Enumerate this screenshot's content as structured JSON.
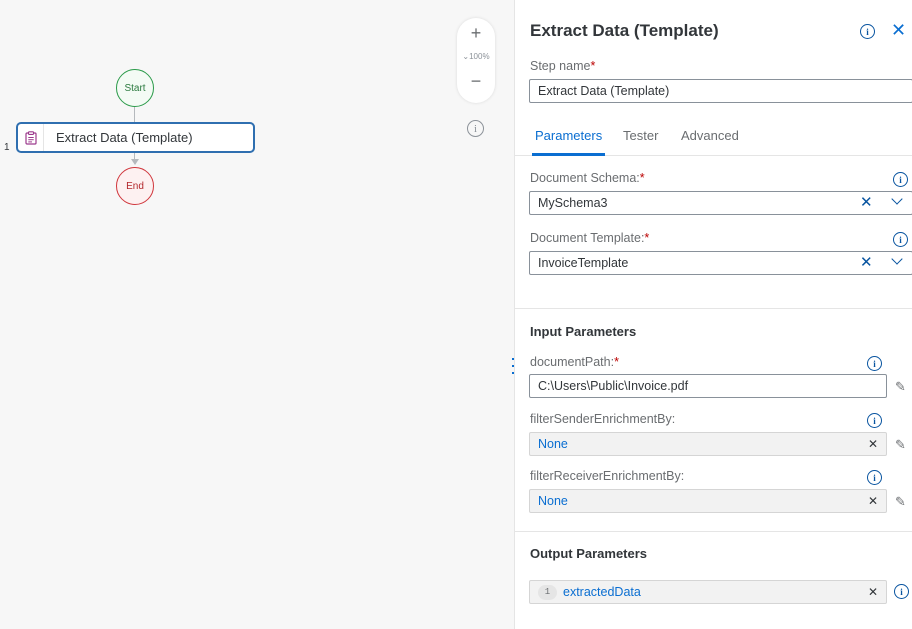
{
  "canvas": {
    "start_label": "Start",
    "end_label": "End",
    "step_number": "1",
    "step_label": "Extract Data (Template)",
    "zoom": {
      "plus": "+",
      "level": "100%",
      "minus": "−"
    }
  },
  "panel": {
    "title": "Extract Data (Template)",
    "step_name": {
      "label": "Step name",
      "value": "Extract Data (Template)"
    },
    "tabs": [
      {
        "label": "Parameters",
        "active": true
      },
      {
        "label": "Tester",
        "active": false
      },
      {
        "label": "Advanced",
        "active": false
      }
    ],
    "document_schema": {
      "label": "Document Schema:",
      "value": "MySchema3"
    },
    "document_template": {
      "label": "Document Template:",
      "value": "InvoiceTemplate"
    },
    "input_parameters": {
      "title": "Input Parameters",
      "document_path": {
        "label": "documentPath:",
        "value": "C:\\Users\\Public\\Invoice.pdf"
      },
      "filter_sender": {
        "label": "filterSenderEnrichmentBy:",
        "value": "None"
      },
      "filter_receiver": {
        "label": "filterReceiverEnrichmentBy:",
        "value": "None"
      }
    },
    "output_parameters": {
      "title": "Output Parameters",
      "extracted": {
        "count": "1",
        "value": "extractedData"
      }
    }
  },
  "colors": {
    "accent": "#0a6ed1",
    "required": "#bb0000",
    "start": "#2b9b4a",
    "end": "#d0363c",
    "step_border": "#2f6fb0"
  },
  "symbols": {
    "required_mark": "*",
    "info": "i",
    "close": "✕",
    "clear": "✕"
  }
}
